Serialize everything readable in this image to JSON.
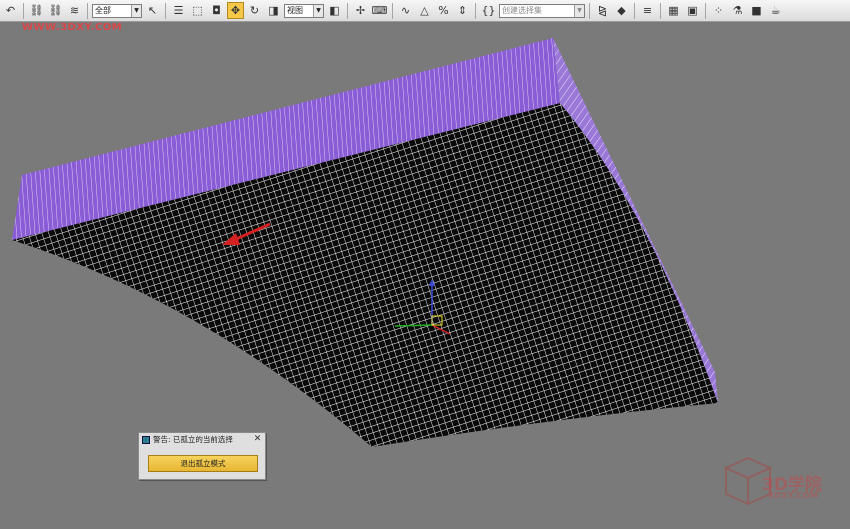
{
  "toolbar": {
    "selection_filter": "全部",
    "ref_coord_system": "视图",
    "named_selection_placeholder": "创建选择集",
    "icons": [
      "undo-icon",
      "link-icon",
      "unlink-icon",
      "bind-spacewarp-icon",
      "select-object-icon",
      "select-by-name-icon",
      "rect-region-icon",
      "window-crossing-icon",
      "move-icon",
      "rotate-icon",
      "scale-icon",
      "pivot-icon",
      "select-manipulate-icon",
      "keyboard-shortcut-icon",
      "snap-3d-icon",
      "angle-snap-icon",
      "percent-snap-icon",
      "spinner-snap-icon",
      "mirror-icon",
      "align-icon",
      "layer-manager-icon",
      "curve-editor-icon",
      "schematic-view-icon",
      "material-editor-icon",
      "render-setup-icon",
      "rendered-frame-icon",
      "render-icon"
    ]
  },
  "watermark": {
    "site": "WWW.3DXY.COM",
    "logo_text": "3D学院",
    "logo_sub": "3DXY.COM"
  },
  "dialog": {
    "title": "警告: 已孤立的当前选择",
    "exit_button": "退出孤立模式",
    "close_symbol": "✕"
  },
  "colors": {
    "viewport_bg": "#7a7a7a",
    "object_side": "#8a5cd6",
    "wire": "#ffffff",
    "arrow": "#d42020",
    "button_accent": "#f0c44a"
  }
}
